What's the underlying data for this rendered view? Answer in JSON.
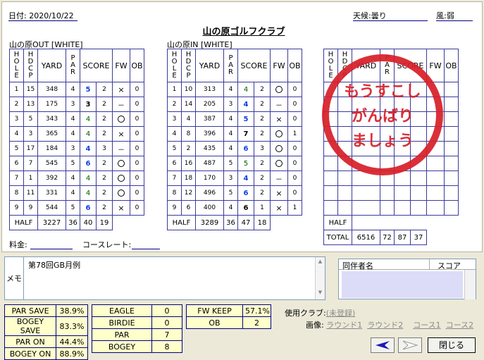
{
  "header": {
    "date_label": "日付:",
    "date": "2020/10/22",
    "weather_label": "天候:",
    "weather": "曇り",
    "wind_label": "風:",
    "wind": "弱"
  },
  "club_name": "山の原ゴルフクラブ",
  "columns": {
    "hole": "HOLE",
    "hdcp": "HDCP",
    "yard": "YARD",
    "par": "PAR",
    "score": "SCORE",
    "fw": "FW",
    "ob": "OB"
  },
  "out": {
    "label": "山の原OUT [WHITE]",
    "rows": [
      {
        "hole": "1",
        "hdcp": "15",
        "yard": "348",
        "par": "4",
        "score": "5",
        "putt": "2",
        "fw": "×",
        "ob": "0",
        "sc": "blue"
      },
      {
        "hole": "2",
        "hdcp": "13",
        "yard": "175",
        "par": "3",
        "score": "3",
        "putt": "2",
        "fw": "－",
        "ob": "0",
        "sc": "black"
      },
      {
        "hole": "3",
        "hdcp": "5",
        "yard": "343",
        "par": "4",
        "score": "4",
        "putt": "2",
        "fw": "○",
        "ob": "0",
        "sc": "green"
      },
      {
        "hole": "4",
        "hdcp": "3",
        "yard": "365",
        "par": "4",
        "score": "4",
        "putt": "2",
        "fw": "×",
        "ob": "0",
        "sc": "green"
      },
      {
        "hole": "5",
        "hdcp": "17",
        "yard": "184",
        "par": "3",
        "score": "4",
        "putt": "3",
        "fw": "－",
        "ob": "0",
        "sc": "blue"
      },
      {
        "hole": "6",
        "hdcp": "7",
        "yard": "545",
        "par": "5",
        "score": "6",
        "putt": "2",
        "fw": "○",
        "ob": "0",
        "sc": "blue"
      },
      {
        "hole": "7",
        "hdcp": "1",
        "yard": "392",
        "par": "4",
        "score": "4",
        "putt": "2",
        "fw": "○",
        "ob": "0",
        "sc": "green"
      },
      {
        "hole": "8",
        "hdcp": "11",
        "yard": "331",
        "par": "4",
        "score": "4",
        "putt": "2",
        "fw": "○",
        "ob": "0",
        "sc": "green"
      },
      {
        "hole": "9",
        "hdcp": "9",
        "yard": "544",
        "par": "5",
        "score": "6",
        "putt": "2",
        "fw": "×",
        "ob": "0",
        "sc": "blue"
      }
    ],
    "half": {
      "label": "HALF",
      "yard": "3227",
      "par": "36",
      "score": "40",
      "putt": "19"
    }
  },
  "in": {
    "label": "山の原IN [WHITE]",
    "rows": [
      {
        "hole": "1",
        "hdcp": "10",
        "yard": "313",
        "par": "4",
        "score": "4",
        "putt": "2",
        "fw": "○",
        "ob": "0",
        "sc": "green"
      },
      {
        "hole": "2",
        "hdcp": "14",
        "yard": "205",
        "par": "3",
        "score": "4",
        "putt": "2",
        "fw": "－",
        "ob": "0",
        "sc": "blue"
      },
      {
        "hole": "3",
        "hdcp": "4",
        "yard": "387",
        "par": "4",
        "score": "5",
        "putt": "2",
        "fw": "×",
        "ob": "0",
        "sc": "blue"
      },
      {
        "hole": "4",
        "hdcp": "8",
        "yard": "396",
        "par": "4",
        "score": "7",
        "putt": "2",
        "fw": "○",
        "ob": "1",
        "sc": "black"
      },
      {
        "hole": "5",
        "hdcp": "2",
        "yard": "435",
        "par": "4",
        "score": "6",
        "putt": "3",
        "fw": "○",
        "ob": "0",
        "sc": "blue"
      },
      {
        "hole": "6",
        "hdcp": "16",
        "yard": "487",
        "par": "5",
        "score": "5",
        "putt": "2",
        "fw": "○",
        "ob": "0",
        "sc": "green"
      },
      {
        "hole": "7",
        "hdcp": "18",
        "yard": "170",
        "par": "3",
        "score": "4",
        "putt": "2",
        "fw": "－",
        "ob": "0",
        "sc": "blue"
      },
      {
        "hole": "8",
        "hdcp": "12",
        "yard": "496",
        "par": "5",
        "score": "6",
        "putt": "2",
        "fw": "×",
        "ob": "0",
        "sc": "blue"
      },
      {
        "hole": "9",
        "hdcp": "6",
        "yard": "400",
        "par": "4",
        "score": "6",
        "putt": "1",
        "fw": "×",
        "ob": "1",
        "sc": "black"
      }
    ],
    "half": {
      "label": "HALF",
      "yard": "3289",
      "par": "36",
      "score": "47",
      "putt": "18"
    }
  },
  "third": {
    "half_label": "HALF",
    "total": {
      "label": "TOTAL",
      "yard": "6516",
      "par": "72",
      "score": "87",
      "putt": "37"
    }
  },
  "stamp": {
    "line1": "もうすこし",
    "line2": "がんばり",
    "line3": "ましょう"
  },
  "fees": {
    "fee_label": "料金:",
    "rating_label": "コースレート:"
  },
  "memo": {
    "label": "メモ",
    "text": "第78回GB月例"
  },
  "companions": {
    "name_header": "同伴者名",
    "score_header": "スコア"
  },
  "stats": {
    "par_save": {
      "label": "PAR SAVE",
      "value": "38.9%"
    },
    "bogey_save": {
      "label": "BOGEY SAVE",
      "value": "83.3%"
    },
    "par_on": {
      "label": "PAR ON",
      "value": "44.4%"
    },
    "bogey_on": {
      "label": "BOGEY ON",
      "value": "88.9%"
    },
    "eagle": {
      "label": "EAGLE",
      "value": "0"
    },
    "birdie": {
      "label": "BIRDIE",
      "value": "0"
    },
    "par": {
      "label": "PAR",
      "value": "7"
    },
    "bogey": {
      "label": "BOGEY",
      "value": "8"
    },
    "fw_keep": {
      "label": "FW KEEP",
      "value": "57.1%"
    },
    "ob": {
      "label": "OB",
      "value": "2"
    }
  },
  "clubs": {
    "label": "使用クラブ:",
    "value": "(未登録)"
  },
  "images": {
    "label": "画像:",
    "round1": "ラウンド1",
    "round2": "ラウンド2",
    "course1": "コース1",
    "course2": "コース2"
  },
  "buttons": {
    "close": "閉じる",
    "prev_icon": "arrow-left-icon",
    "next_icon": "arrow-right-icon"
  },
  "colors": {
    "grid": "#3a3a9a",
    "blue_score": "#1040e0",
    "stamp": "#d8202a",
    "stats_bg": "#ffffcc",
    "companion_bg": "#dcdcf8"
  }
}
